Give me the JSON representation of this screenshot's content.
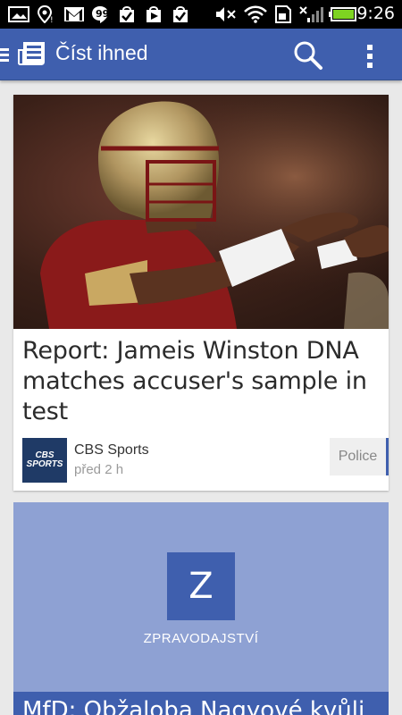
{
  "status_bar": {
    "time": "9:26",
    "icons": [
      "gallery-icon",
      "location-icon",
      "gmail-icon",
      "hangouts-icon",
      "check-bag-icon",
      "play-store-icon",
      "check-bag-icon",
      "mute-icon",
      "wifi-icon",
      "sd-card-icon",
      "signal-icon",
      "battery-icon"
    ]
  },
  "app_bar": {
    "title": "Číst ihned",
    "icons": [
      "up-icon",
      "newspaper-icon",
      "search-icon",
      "overflow-menu-icon"
    ]
  },
  "cards": [
    {
      "headline": "Report: Jameis Winston DNA matches accuser's sample in test",
      "source_logo_text": "CBS SPORTS",
      "source": "CBS Sports",
      "time": "před 2 h",
      "topic": "Police"
    },
    {
      "section_letter": "Z",
      "section_name": "ZPRAVODAJSTVÍ",
      "headline": "MfD: Obžaloba Nagyové kvůli"
    }
  ],
  "colors": {
    "app_bar": "#3f5fae",
    "section_card": "#8ea1d3",
    "background": "#e9e9e9"
  }
}
